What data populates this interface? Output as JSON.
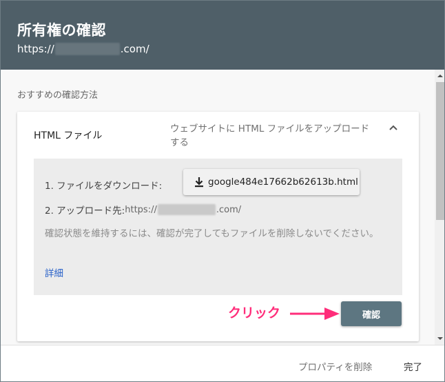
{
  "header": {
    "title": "所有権の確認",
    "url_prefix": "https://",
    "url_suffix": ".com/"
  },
  "section_label": "おすすめの確認方法",
  "method_card": {
    "title": "HTML ファイル",
    "description": "ウェブサイトに HTML ファイルをアップロードする",
    "step1_label": "1. ファイルをダウンロード:",
    "download_file": "google484e17662b62613b.html",
    "step2_label": "2. アップロード先:",
    "step2_url_prefix": "https://",
    "step2_url_suffix": ".com/",
    "note": "確認状態を維持するには、確認が完了してもファイルを削除しないでください。",
    "details_link": "詳細",
    "confirm_label": "確認"
  },
  "annotation": {
    "label": "クリック",
    "color": "#ff2d7a"
  },
  "footer": {
    "delete_label": "プロパティを削除",
    "done_label": "完了"
  },
  "icons": {
    "download": "download-icon",
    "collapse": "chevron-up-icon"
  },
  "colors": {
    "header_bg": "#4f5f68",
    "confirm_bg": "#5d7681",
    "link": "#2a62c9"
  }
}
